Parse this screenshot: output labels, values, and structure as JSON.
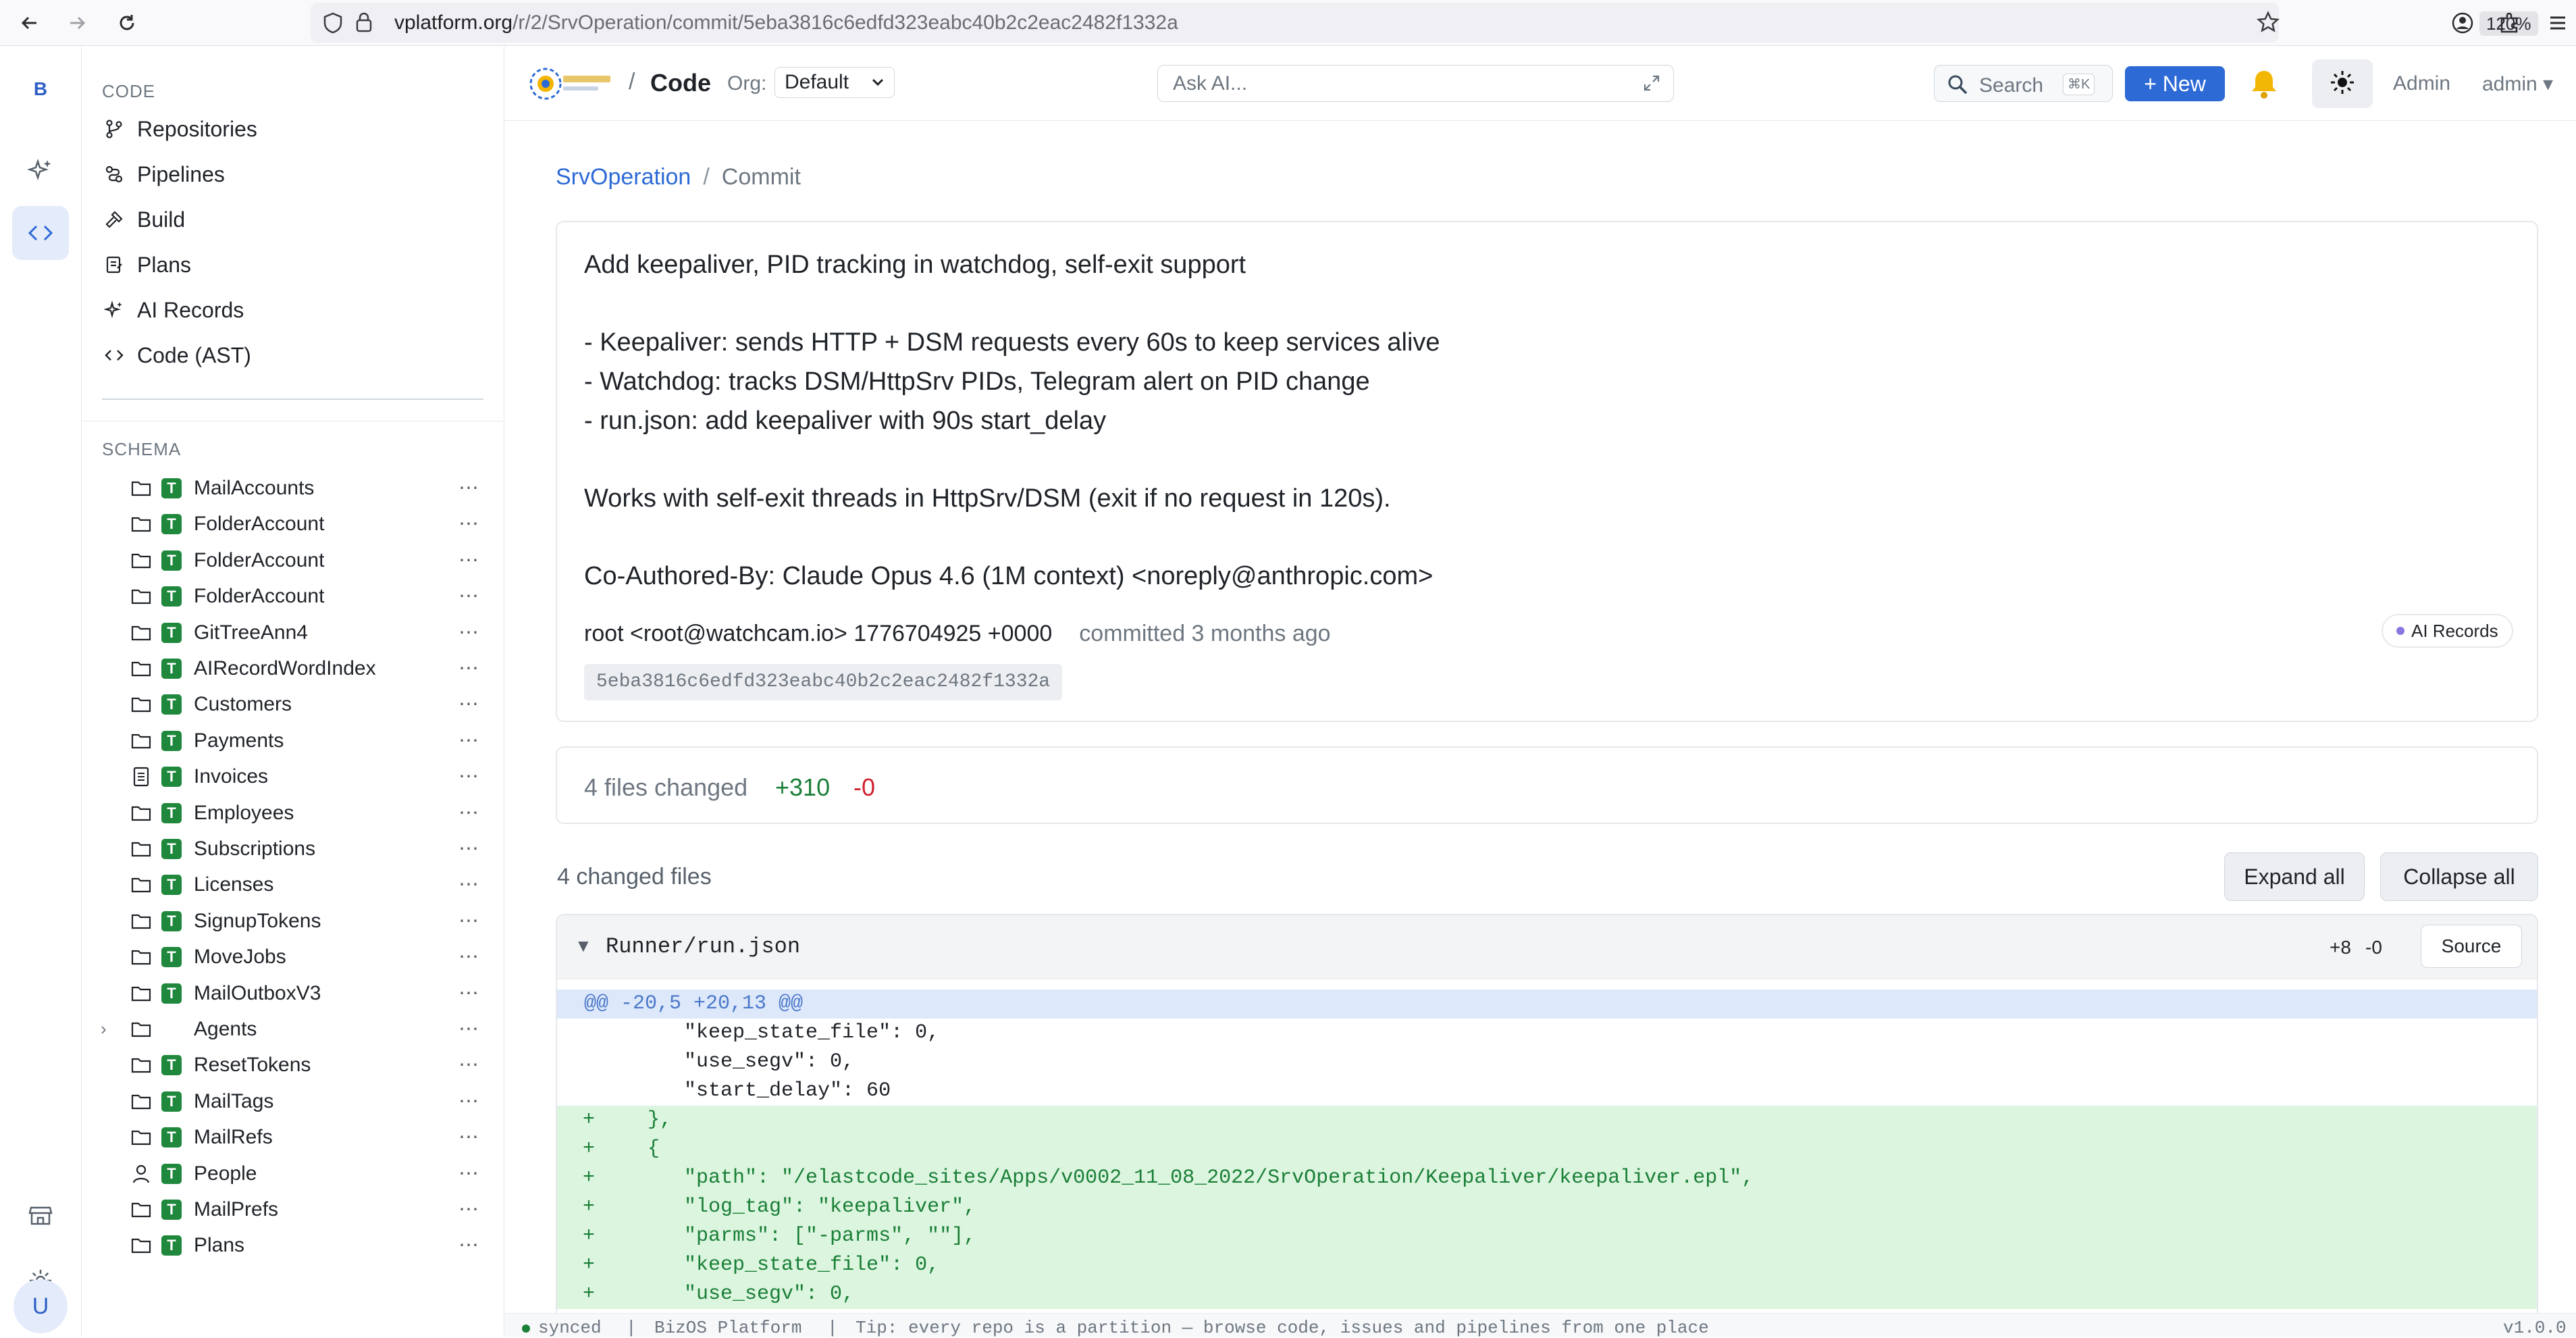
{
  "browser": {
    "url_host": "vplatform.org",
    "url_path": "/r/2/SrvOperation/commit/5eba3816c6edfd323eabc40b2c2eac2482f1332a",
    "zoom": "120%"
  },
  "rail": {
    "brand_letter": "B",
    "avatar_letter": "U"
  },
  "sidebar": {
    "code_label": "CODE",
    "nav": [
      {
        "label": "Repositories",
        "icon": "branch-icon"
      },
      {
        "label": "Pipelines",
        "icon": "pipeline-icon"
      },
      {
        "label": "Build",
        "icon": "hammer-icon"
      },
      {
        "label": "Plans",
        "icon": "plans-icon"
      },
      {
        "label": "AI Records",
        "icon": "sparkle-icon"
      },
      {
        "label": "Code (AST)",
        "icon": "code-icon"
      }
    ],
    "schema_label": "SCHEMA",
    "schema": [
      {
        "name": "MailAccounts",
        "icon": "folder-icon",
        "type": "T"
      },
      {
        "name": "FolderAccount",
        "icon": "folder-icon",
        "type": "T"
      },
      {
        "name": "FolderAccount",
        "icon": "folder-icon",
        "type": "T"
      },
      {
        "name": "FolderAccount",
        "icon": "folder-icon",
        "type": "T"
      },
      {
        "name": "GitTreeAnn4",
        "icon": "folder-icon",
        "type": "T"
      },
      {
        "name": "AIRecordWordIndex",
        "icon": "folder-icon",
        "type": "T"
      },
      {
        "name": "Customers",
        "icon": "folder-icon",
        "type": "T"
      },
      {
        "name": "Payments",
        "icon": "folder-icon",
        "type": "T"
      },
      {
        "name": "Invoices",
        "icon": "document-icon",
        "type": "T"
      },
      {
        "name": "Employees",
        "icon": "folder-icon",
        "type": "T"
      },
      {
        "name": "Subscriptions",
        "icon": "folder-icon",
        "type": "T"
      },
      {
        "name": "Licenses",
        "icon": "folder-icon",
        "type": "T"
      },
      {
        "name": "SignupTokens",
        "icon": "folder-icon",
        "type": "T"
      },
      {
        "name": "MoveJobs",
        "icon": "folder-icon",
        "type": "T"
      },
      {
        "name": "MailOutboxV3",
        "icon": "folder-icon",
        "type": "T"
      },
      {
        "name": "Agents",
        "icon": "folder-icon",
        "type": "",
        "expandable": true
      },
      {
        "name": "ResetTokens",
        "icon": "folder-icon",
        "type": "T"
      },
      {
        "name": "MailTags",
        "icon": "folder-icon",
        "type": "T"
      },
      {
        "name": "MailRefs",
        "icon": "folder-icon",
        "type": "T"
      },
      {
        "name": "People",
        "icon": "person-icon",
        "type": "T"
      },
      {
        "name": "MailPrefs",
        "icon": "folder-icon",
        "type": "T"
      },
      {
        "name": "Plans",
        "icon": "folder-icon",
        "type": "T"
      }
    ],
    "more_glyph": "⋯"
  },
  "header": {
    "sep": "/",
    "title": "Code",
    "org_label": "Org:",
    "org_value": "Default",
    "ask_placeholder": "Ask AI...",
    "search_label": "Search",
    "search_kbd": "⌘K",
    "new_label": "+ New",
    "admin_link": "Admin",
    "admin_menu": "admin ▾"
  },
  "breadcrumb": {
    "repo": "SrvOperation",
    "sep": "/",
    "current": "Commit"
  },
  "commit": {
    "message_lines": [
      "Add keepaliver, PID tracking in watchdog, self-exit support",
      "- Keepaliver: sends HTTP + DSM requests every 60s to keep services alive",
      "- Watchdog: tracks DSM/HttpSrv PIDs, Telegram alert on PID change",
      "- run.json: add keepaliver with 90s start_delay",
      "Works with self-exit threads in HttpSrv/DSM (exit if no request in 120s).",
      "Co-Authored-By: Claude Opus 4.6 (1M context) <noreply@anthropic.com>"
    ],
    "author": "root <root@watchcam.io> 1776704925 +0000",
    "committed": "committed 3 months ago",
    "sha": "5eba3816c6edfd323eabc40b2c2eac2482f1332a",
    "ai_badge": "AI Records"
  },
  "stats": {
    "files_changed": "4 files changed",
    "additions": "+310",
    "deletions": "-0"
  },
  "changed": {
    "label": "4 changed files",
    "expand_all": "Expand all",
    "collapse_all": "Collapse all"
  },
  "file": {
    "name": "Runner/run.json",
    "additions": "+8",
    "deletions": "-0",
    "source_btn": "Source",
    "lines": [
      {
        "kind": "hunk",
        "marker": "",
        "text": "@@ -20,5 +20,13 @@"
      },
      {
        "kind": "ctx",
        "marker": "",
        "text": "      \"keep_state_file\": 0,"
      },
      {
        "kind": "ctx",
        "marker": "",
        "text": "      \"use_segv\": 0,"
      },
      {
        "kind": "ctx",
        "marker": "",
        "text": "      \"start_delay\": 60"
      },
      {
        "kind": "add",
        "marker": "+",
        "text": "   },"
      },
      {
        "kind": "add",
        "marker": "+",
        "text": "   {"
      },
      {
        "kind": "add",
        "marker": "+",
        "text": "      \"path\": \"/elastcode_sites/Apps/v0002_11_08_2022/SrvOperation/Keepaliver/keepaliver.epl\","
      },
      {
        "kind": "add",
        "marker": "+",
        "text": "      \"log_tag\": \"keepaliver\","
      },
      {
        "kind": "add",
        "marker": "+",
        "text": "      \"parms\": [\"-parms\", \"\"],"
      },
      {
        "kind": "add",
        "marker": "+",
        "text": "      \"keep_state_file\": 0,"
      },
      {
        "kind": "add",
        "marker": "+",
        "text": "      \"use_segv\": 0,"
      }
    ]
  },
  "status": {
    "synced": "synced",
    "sep": "|",
    "platform": "BizOS Platform",
    "tip": "Tip: every repo is a partition — browse code, issues and pipelines from one place",
    "version": "v1.0.0"
  },
  "colors": {
    "accent": "#2d6ad6",
    "add_bg": "#dcf5df",
    "hunk_bg": "#dde8fb",
    "table_badge": "#1f883d"
  }
}
